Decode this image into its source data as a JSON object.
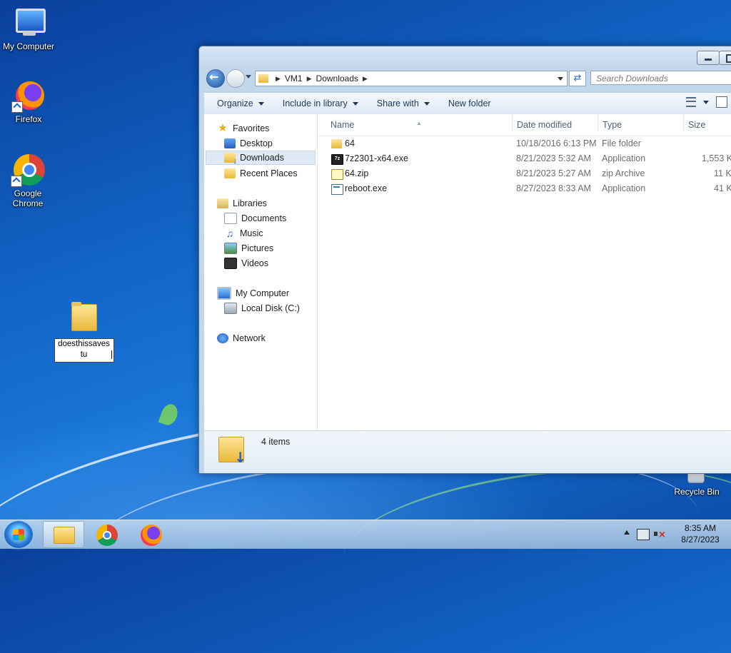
{
  "desktop": {
    "icons": {
      "my_computer": "My Computer",
      "firefox": "Firefox",
      "chrome": "Google Chrome",
      "recycle_bin": "Recycle Bin"
    },
    "rename_field_value": "doesthissavestu"
  },
  "explorer": {
    "address": {
      "crumbs": [
        "VM1",
        "Downloads"
      ]
    },
    "search_placeholder": "Search Downloads",
    "toolbar": {
      "organize": "Organize",
      "include_in_library": "Include in library",
      "share_with": "Share with",
      "new_folder": "New folder"
    },
    "nav": {
      "favorites": "Favorites",
      "desktop": "Desktop",
      "downloads": "Downloads",
      "recent_places": "Recent Places",
      "libraries": "Libraries",
      "documents": "Documents",
      "music": "Music",
      "pictures": "Pictures",
      "videos": "Videos",
      "my_computer": "My Computer",
      "local_disk": "Local Disk (C:)",
      "network": "Network"
    },
    "columns": {
      "name": "Name",
      "date": "Date modified",
      "type": "Type",
      "size": "Size"
    },
    "files": [
      {
        "name": "64",
        "date": "10/18/2016 6:13 PM",
        "type": "File folder",
        "size": "",
        "icon": "folder-icon"
      },
      {
        "name": "7z2301-x64.exe",
        "date": "8/21/2023 5:32 AM",
        "type": "Application",
        "size": "1,553 K",
        "icon": "7zip-installer-icon"
      },
      {
        "name": "64.zip",
        "date": "8/21/2023 5:27 AM",
        "type": "zip Archive",
        "size": "11 K",
        "icon": "zip-archive-icon"
      },
      {
        "name": "reboot.exe",
        "date": "8/27/2023 8:33 AM",
        "type": "Application",
        "size": "41 K",
        "icon": "application-icon"
      }
    ],
    "details_pane": {
      "item_count": "4 items"
    }
  },
  "taskbar": {
    "clock_time": "8:35 AM",
    "clock_date": "8/27/2023"
  }
}
